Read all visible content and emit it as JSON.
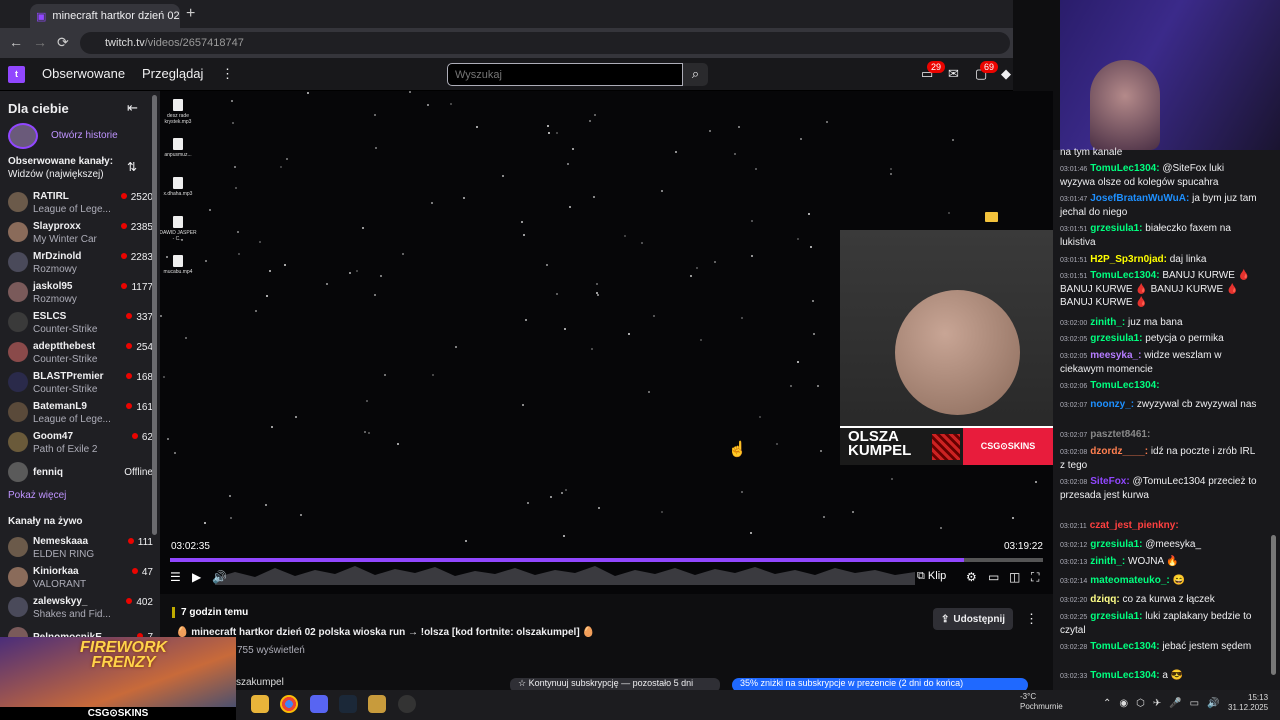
{
  "browser": {
    "tab_title": "minecraft hartkor dzień 02 p",
    "new_tab": "+",
    "url_host": "twitch.tv",
    "url_path": "/videos/2657418747",
    "back": "←",
    "forward": "→",
    "reload": "⟳"
  },
  "topnav": {
    "followed": "Obserwowane",
    "browse": "Przeglądaj",
    "more": "⋮",
    "search_placeholder": "Wyszukaj",
    "notif_count": "29",
    "activity_count": "69"
  },
  "sidebar": {
    "title": "Dla ciebie",
    "collapse": "⇤",
    "stories": "Otwórz historie",
    "followed_heading": "Obserwowane kanały:",
    "followed_sort": "Widzów (największej)",
    "followed": [
      {
        "name": "RATIRL",
        "game": "League of Lege...",
        "viewers": "2520"
      },
      {
        "name": "Slayproxx",
        "game": "My Winter Car",
        "viewers": "2385"
      },
      {
        "name": "MrDzinold",
        "game": "Rozmowy",
        "viewers": "2283"
      },
      {
        "name": "jaskol95",
        "game": "Rozmowy",
        "viewers": "1177"
      },
      {
        "name": "ESLCS",
        "game": "Counter-Strike",
        "viewers": "337"
      },
      {
        "name": "adeptthebest",
        "game": "Counter-Strike",
        "viewers": "254"
      },
      {
        "name": "BLASTPremier",
        "game": "Counter-Strike",
        "viewers": "168"
      },
      {
        "name": "BatemanL9",
        "game": "League of Lege...",
        "viewers": "161"
      },
      {
        "name": "Goom47",
        "game": "Path of Exile 2",
        "viewers": "62"
      },
      {
        "name": "fenniq",
        "game": "",
        "viewers": "Offline"
      }
    ],
    "show_more": "Pokaż więcej",
    "live_heading": "Kanały na żywo",
    "live": [
      {
        "name": "Nemeskaaa",
        "game": "ELDEN RING",
        "viewers": "111"
      },
      {
        "name": "Kiniorkaa",
        "game": "VALORANT",
        "viewers": "47"
      },
      {
        "name": "zalewskyy_",
        "game": "Shakes and Fid...",
        "viewers": "402"
      },
      {
        "name": "PelnomocnikE...",
        "game": "",
        "viewers": "7"
      }
    ]
  },
  "player": {
    "time_current": "03:02:35",
    "time_total": "03:19:22",
    "progress": 0.91,
    "desktop_icons": [
      "desz rade krystek.mp3",
      "anpusmuz...",
      "x.dhaha.mp3",
      "DAWID JASPER - C...",
      "mucabu.mp4"
    ],
    "clip": "Klip",
    "overlay_brand": "OLSZA KUMPEL",
    "overlay_sponsor": "CSG⊙SKINS"
  },
  "video_info": {
    "ago": "7 godzin temu",
    "title": "minecraft hartkor dzień 02 polska wioska run → !olsza [kod fortnite: olszakumpel]",
    "views": "755 wyświetleń",
    "share": "Udostępnij",
    "more": "⋮",
    "channel_partial": "szakumpel",
    "sub_continue": "Kontynuuj subskrypcję — pozostało 5 dni",
    "sub_discount": "35% zniżki na subskrypcje w prezencie (2 dni do końca)"
  },
  "promo": {
    "title_line1": "FIREWORK",
    "title_line2": "FRENZY",
    "sponsor": "CSG⊙SKINS"
  },
  "taskbar": {
    "weather_temp": "-3°C",
    "weather_desc": "Pochmurnie",
    "time": "15:13",
    "date": "31.12.2025"
  },
  "chat": [
    {
      "ts": "",
      "user": "",
      "color": "#efeff1",
      "text": "na tym kanale"
    },
    {
      "ts": "03:01:46",
      "user": "TomuLec1304:",
      "color": "#00ff7f",
      "text": "@SiteFox luki wyzywa olsze od kolegów spucahra"
    },
    {
      "ts": "03:01:47",
      "user": "JosefBratanWuWuA:",
      "color": "#1e90ff",
      "text": "ja bym juz tam jechal do niego"
    },
    {
      "ts": "03:01:51",
      "user": "grzesiula1:",
      "color": "#00ff7f",
      "text": "białeczko faxem na lukistiva"
    },
    {
      "ts": "03:01:51",
      "user": "H2P_Sp3rn0jad:",
      "color": "#ffff00",
      "text": "daj linka"
    },
    {
      "ts": "03:01:51",
      "user": "TomuLec1304:",
      "color": "#00ff7f",
      "text": "BANUJ KURWE 🩸 BANUJ KURWE 🩸 BANUJ KURWE 🩸 BANUJ KURWE 🩸"
    },
    {
      "ts": "03:02:00",
      "user": "zinith_:",
      "color": "#00ff7f",
      "text": "juz ma bana"
    },
    {
      "ts": "03:02:05",
      "user": "grzesiula1:",
      "color": "#00ff7f",
      "text": "petycja o permika"
    },
    {
      "ts": "03:02:05",
      "user": "meesyka_:",
      "color": "#b57cff",
      "text": "widze weszlam w ciekawym momencie"
    },
    {
      "ts": "03:02:06",
      "user": "TomuLec1304:",
      "color": "#00ff7f",
      "text": ""
    },
    {
      "ts": "03:02:07",
      "user": "noonzy_:",
      "color": "#1e90ff",
      "text": "zwyzywal cb zwyzywal nas"
    },
    {
      "ts": "03:02:07",
      "user": "pasztet8461:",
      "color": "#888888",
      "text": ""
    },
    {
      "ts": "03:02:08",
      "user": "dzordz____:",
      "color": "#ff7f50",
      "text": "idź na poczte i zrób IRL z tego"
    },
    {
      "ts": "03:02:08",
      "user": "SiteFox:",
      "color": "#9147ff",
      "text": "@TomuLec1304 przecież to przesada jest kurwa"
    },
    {
      "ts": "03:02:11",
      "user": "czat_jest_pienkny:",
      "color": "#ff4040",
      "text": ""
    },
    {
      "ts": "03:02:12",
      "user": "grzesiula1:",
      "color": "#00ff7f",
      "text": "@meesyka_"
    },
    {
      "ts": "03:02:13",
      "user": "zinith_:",
      "color": "#00ff7f",
      "text": "WOJNA 🔥"
    },
    {
      "ts": "03:02:14",
      "user": "mateomateuko_:",
      "color": "#00ff7f",
      "text": "😄"
    },
    {
      "ts": "03:02:20",
      "user": "dziqq:",
      "color": "#ffff88",
      "text": "co za kurwa z łączek"
    },
    {
      "ts": "03:02:25",
      "user": "grzesiula1:",
      "color": "#00ff7f",
      "text": "luki zaplakany bedzie to czytal"
    },
    {
      "ts": "03:02:28",
      "user": "TomuLec1304:",
      "color": "#00ff7f",
      "text": "jebać jestem sędem"
    },
    {
      "ts": "03:02:33",
      "user": "TomuLec1304:",
      "color": "#00ff7f",
      "text": "a 😎"
    }
  ],
  "colors": {
    "twitch_purple": "#9147ff",
    "live_red": "#eb0400",
    "chat_bg": "#18181b"
  }
}
